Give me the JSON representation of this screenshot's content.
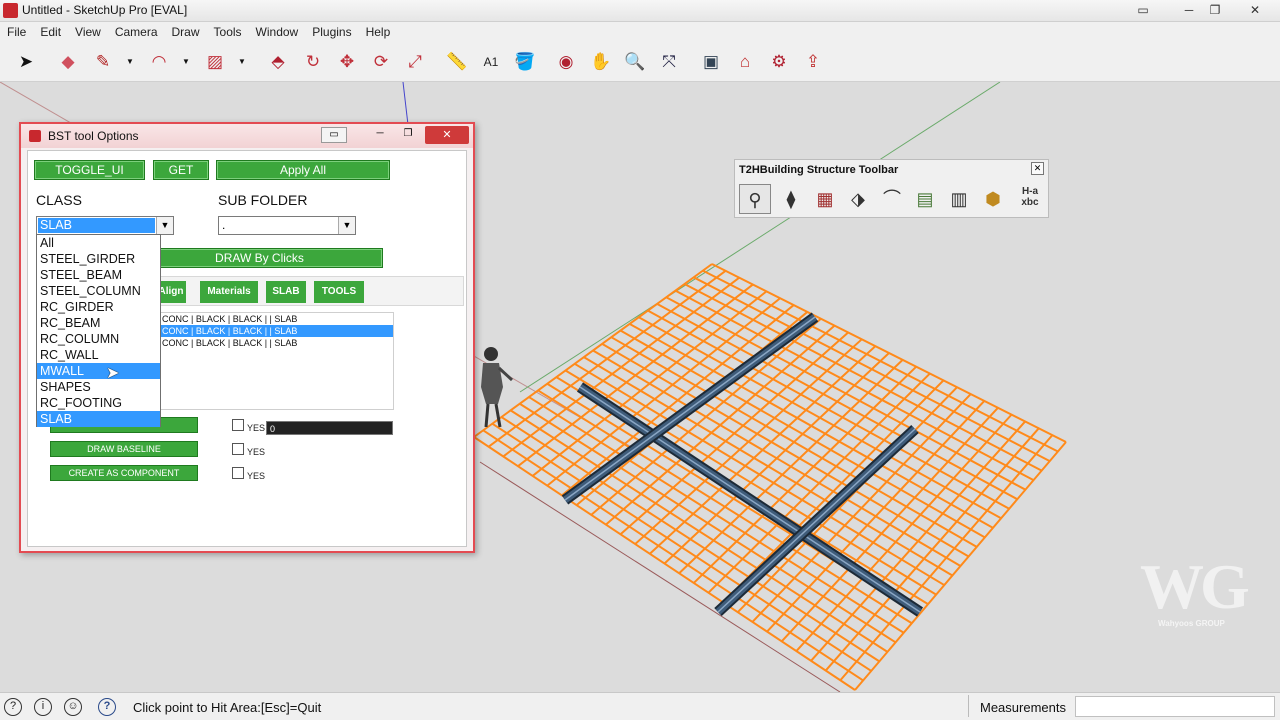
{
  "window": {
    "title": "Untitled - SketchUp Pro [EVAL]",
    "controls": [
      "▭",
      "─",
      "❐",
      "✕"
    ]
  },
  "menu": [
    "File",
    "Edit",
    "View",
    "Camera",
    "Draw",
    "Tools",
    "Window",
    "Plugins",
    "Help"
  ],
  "toolbar_icons": [
    "select-icon",
    "eraser-icon",
    "pencil-icon",
    "arc-icon",
    "rectangle-icon",
    "push-pull-icon",
    "follow-me-icon",
    "move-icon",
    "rotate-icon",
    "scale-icon",
    "tape-measure-icon",
    "text-icon",
    "paint-bucket-icon",
    "orbit-icon",
    "pan-icon",
    "zoom-icon",
    "zoom-extents-icon",
    "model-info-icon",
    "warehouse-icon",
    "extension-icon",
    "share-icon"
  ],
  "dialog": {
    "title": "BST tool Options",
    "buttons": {
      "toggle_ui": "TOGGLE_UI",
      "get": "GET",
      "apply_all": "Apply All",
      "draw_clicks": "DRAW By Clicks"
    },
    "class_label": "CLASS",
    "class_value": "SLAB",
    "subfolder_label": "SUB FOLDER",
    "subfolder_value": ".",
    "class_options": [
      "All",
      "STEEL_GIRDER",
      "STEEL_BEAM",
      "STEEL_COLUMN",
      "RC_GIRDER",
      "RC_BEAM",
      "RC_COLUMN",
      "RC_WALL",
      "MWALL",
      "SHAPES",
      "RC_FOOTING",
      "SLAB"
    ],
    "highlighted_options": [
      "MWALL",
      "SLAB"
    ],
    "tabs": [
      "Align",
      "Materials",
      "SLAB",
      "TOOLS"
    ],
    "list_items": [
      {
        "text": "CONC | BLACK | BLACK | | SLAB",
        "selected": false
      },
      {
        "text": "CONC | BLACK | BLACK | | SLAB",
        "selected": true
      },
      {
        "text": "CONC | BLACK | BLACK | | SLAB",
        "selected": false
      }
    ],
    "actions": {
      "draw_baseline": "DRAW BASELINE",
      "create_component": "CREATE AS COMPONENT"
    },
    "checkbox_label": "YES",
    "offset_value": "0"
  },
  "t2h": {
    "title": "T2HBuilding Structure Toolbar",
    "close": "✕",
    "icons": [
      "column-tool-icon",
      "stair-tool-icon",
      "wall-tool-icon",
      "beam-tool-icon",
      "roof-tool-icon",
      "table-tool-icon",
      "material-tool-icon",
      "box-tool-icon"
    ],
    "label_icon": "H-a xbc"
  },
  "statusbar": {
    "message": "Click point to Hit Area:[Esc]=Quit",
    "measurements_label": "Measurements"
  },
  "watermark": {
    "logo": "WG",
    "text": "Wahyoos GROUP"
  },
  "colors": {
    "grid": "#ff8a1a",
    "beam": "#3f5c7a",
    "dialog_border": "#e34b52",
    "button_green": "#3ca73c",
    "highlight": "#3399ff"
  }
}
